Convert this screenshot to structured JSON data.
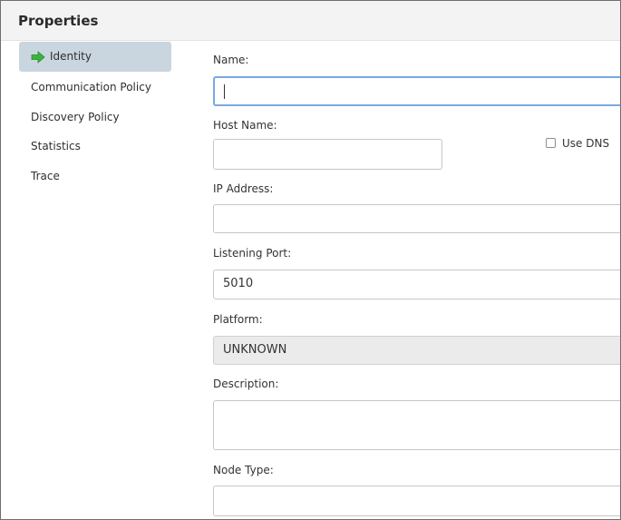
{
  "header": {
    "title": "Properties"
  },
  "sidebar": {
    "items": [
      {
        "label": "Identity",
        "icon": "green-arrow-icon",
        "active": true
      },
      {
        "label": "Communication Policy"
      },
      {
        "label": "Discovery Policy"
      },
      {
        "label": "Statistics"
      },
      {
        "label": "Trace"
      }
    ]
  },
  "form": {
    "name": {
      "label": "Name:",
      "value": ""
    },
    "host_name": {
      "label": "Host Name:",
      "value": ""
    },
    "use_dns": {
      "label": "Use DNS",
      "checked": false
    },
    "ip_address": {
      "label": "IP Address:",
      "value": ""
    },
    "listening_port": {
      "label": "Listening Port:",
      "value": "5010"
    },
    "platform": {
      "label": "Platform:",
      "value": "UNKNOWN"
    },
    "description": {
      "label": "Description:",
      "value": ""
    },
    "node_type": {
      "label": "Node Type:",
      "value": ""
    }
  },
  "colors": {
    "active_item_bg": "#c9d6e0",
    "focus_border": "#79a9df",
    "arrow_green": "#3cb43c"
  }
}
